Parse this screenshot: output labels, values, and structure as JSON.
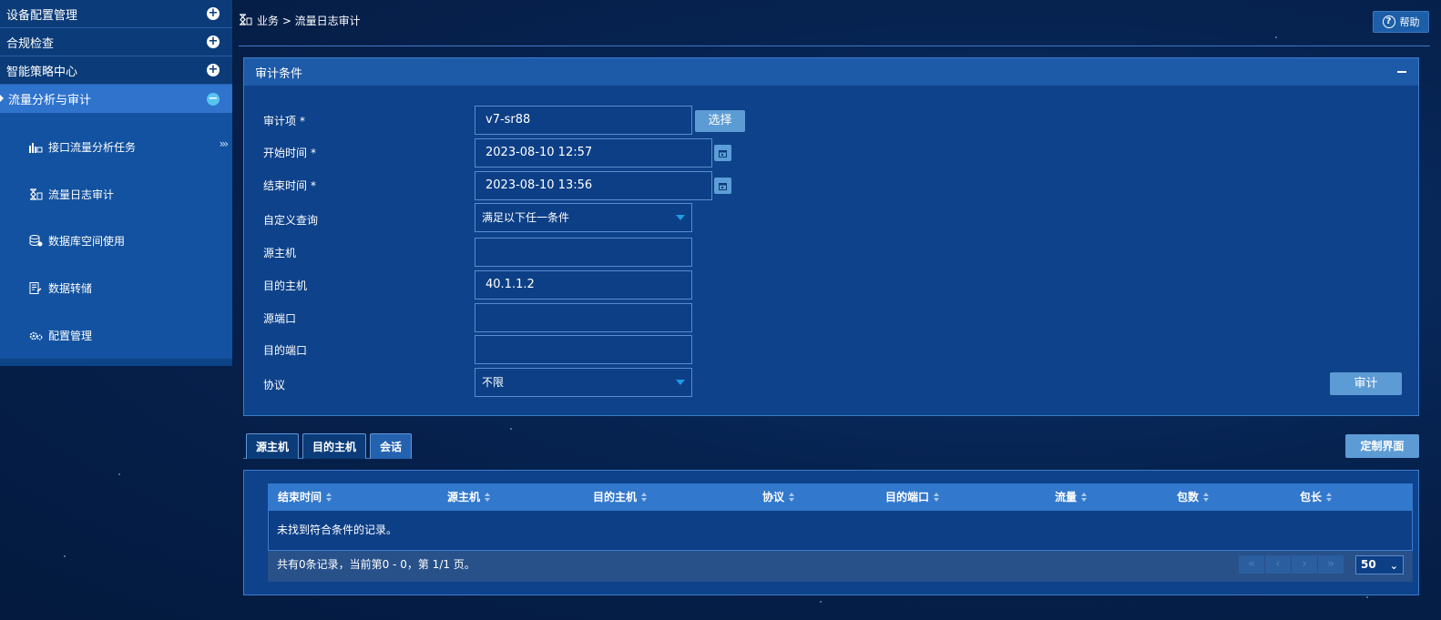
{
  "sidebar": {
    "menu": [
      {
        "label": "设备配置管理",
        "state": "collapsed"
      },
      {
        "label": "合规检查",
        "state": "collapsed"
      },
      {
        "label": "智能策略中心",
        "state": "collapsed"
      },
      {
        "label": "流量分析与审计",
        "state": "expanded"
      }
    ],
    "plus_symbol": "+",
    "minus_symbol": "−",
    "submenu": [
      {
        "label": "接口流量分析任务",
        "icon": "bar-chart-icon",
        "arrow": "›››"
      },
      {
        "label": "流量日志审计",
        "icon": "hourglass-icon"
      },
      {
        "label": "数据库空间使用",
        "icon": "database-icon"
      },
      {
        "label": "数据转储",
        "icon": "document-icon"
      },
      {
        "label": "配置管理",
        "icon": "gears-icon"
      }
    ]
  },
  "header": {
    "breadcrumb": "业务 > 流量日志审计",
    "help_label": "帮助",
    "help_symbol": "?"
  },
  "form": {
    "title": "审计条件",
    "required_mark": "*",
    "audit_item": {
      "label": "审计项",
      "value": "v7-sr88",
      "select_button": "选择"
    },
    "start_time": {
      "label": "开始时间",
      "value": "2023-08-10 12:57"
    },
    "end_time": {
      "label": "结束时间",
      "value": "2023-08-10 13:56"
    },
    "custom_query": {
      "label": "自定义查询",
      "value": "满足以下任一条件"
    },
    "src_host": {
      "label": "源主机",
      "value": ""
    },
    "dst_host": {
      "label": "目的主机",
      "value": "40.1.1.2"
    },
    "src_port": {
      "label": "源端口",
      "value": ""
    },
    "dst_port": {
      "label": "目的端口",
      "value": ""
    },
    "protocol": {
      "label": "协议",
      "value": "不限"
    },
    "audit_button": "审计"
  },
  "tabs": [
    {
      "label": "源主机",
      "active": false
    },
    {
      "label": "目的主机",
      "active": false
    },
    {
      "label": "会话",
      "active": true
    }
  ],
  "custom_view_button": "定制界面",
  "table": {
    "columns": [
      "结束时间",
      "源主机",
      "目的主机",
      "协议",
      "目的端口",
      "流量",
      "包数",
      "包长"
    ],
    "empty_message": "未找到符合条件的记录。",
    "footer": "共有0条记录，当前第0 - 0，第 1/1 页。",
    "pager": [
      "«",
      "‹",
      "›",
      "»"
    ],
    "page_size": "50",
    "page_size_chevron": "⌄"
  },
  "colors": {
    "background": "#06224f",
    "panel": "#0e428a",
    "panel_header": "#1d5aa8",
    "active_menu": "#2f73cc",
    "table_header": "#3278cc",
    "button": "#5d9bd5"
  }
}
